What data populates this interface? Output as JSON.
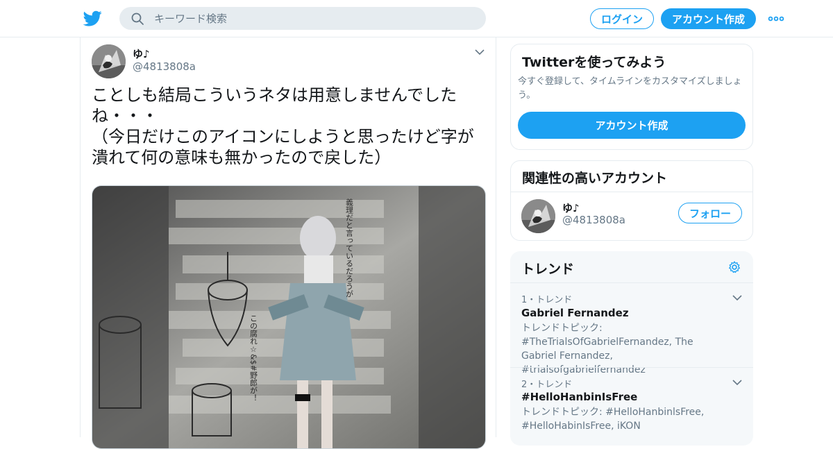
{
  "header": {
    "search_placeholder": "キーワード検索",
    "login_label": "ログイン",
    "signup_label": "アカウント作成",
    "logo_icon": "twitter-bird-icon",
    "more_icon": "more-horizontal-icon",
    "accent_color": "#1da1f2"
  },
  "tweet": {
    "display_name": "ゆ♪",
    "handle": "@4813808a",
    "text": "ことしも結局こういうネタは用意しませんでした\nね・・・\n（今日だけこのアイコンにしようと思ったけど字が\n潰れて何の意味も無かったので戻した）",
    "media_caption_1": "義理だと言っているだろうが",
    "media_caption_2": "この腐れ☆&$#野郎が！"
  },
  "signup_card": {
    "title": "Twitterを使ってみよう",
    "description": "今すぐ登録して、タイムラインをカスタマイズしましょう。",
    "button_label": "アカウント作成"
  },
  "related_card": {
    "title": "関連性の高いアカウント",
    "display_name": "ゆ♪",
    "handle": "@4813808a",
    "follow_label": "フォロー"
  },
  "trends_card": {
    "title": "トレンド",
    "items": [
      {
        "meta": "1・トレンド",
        "name": "Gabriel Fernandez",
        "description": "トレンドトピック: #TheTrialsOfGabrielFernandez, The Gabriel Fernandez, #trialsofgabrielfernandez"
      },
      {
        "meta": "2・トレンド",
        "name": "#HelloHanbinIsFree",
        "description": "トレンドトピック: #HelloHanbinlsFree, #HelloHabinIsFree, iKON"
      }
    ]
  }
}
